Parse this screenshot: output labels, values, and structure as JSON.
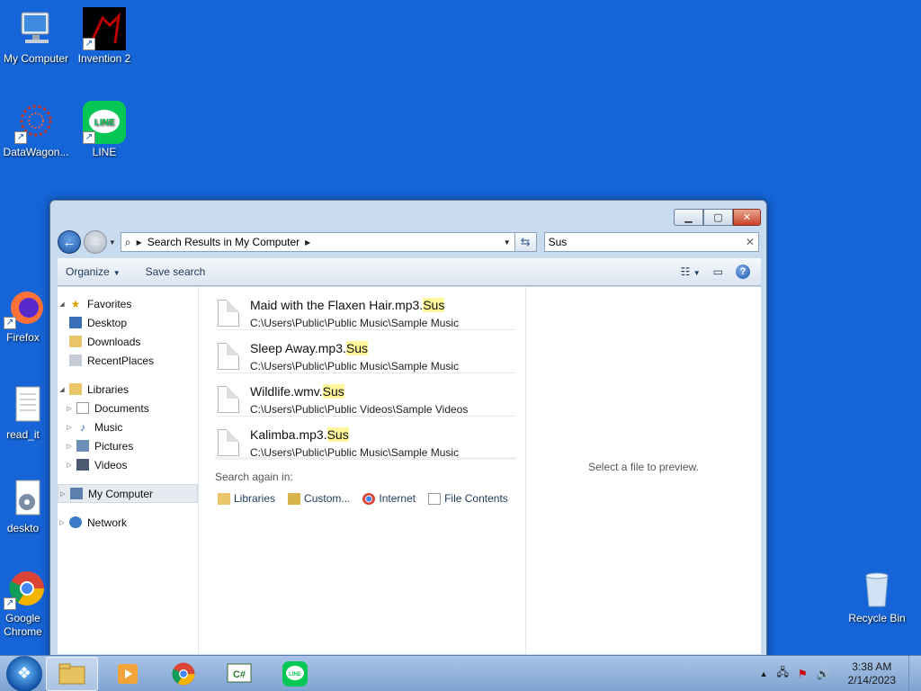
{
  "desktop": {
    "icons": [
      {
        "label": "My Computer",
        "icon": "computer-icon"
      },
      {
        "label": "Invention 2",
        "icon": "invention-icon"
      },
      {
        "label": "DataWagon...",
        "icon": "datawagon-icon"
      },
      {
        "label": "LINE",
        "icon": "line-icon"
      },
      {
        "label": "Firefox",
        "icon": "firefox-icon"
      },
      {
        "label": "read_it",
        "icon": "text-file-icon"
      },
      {
        "label": "deskto",
        "icon": "gear-file-icon"
      },
      {
        "label": "Google Chrome",
        "icon": "chrome-icon"
      },
      {
        "label": "Recycle Bin",
        "icon": "recycle-bin-icon"
      }
    ]
  },
  "explorer": {
    "address": {
      "crumb": "Search Results in My Computer"
    },
    "search": {
      "value": "Sus"
    },
    "toolbar": {
      "organize": "Organize",
      "save_search": "Save search"
    },
    "nav": {
      "favorites": "Favorites",
      "desktop": "Desktop",
      "downloads": "Downloads",
      "recent": "RecentPlaces",
      "libraries": "Libraries",
      "documents": "Documents",
      "music": "Music",
      "pictures": "Pictures",
      "videos": "Videos",
      "computer": "My Computer",
      "network": "Network"
    },
    "results": [
      {
        "name": "Maid with the Flaxen Hair.mp3.",
        "match": "Sus",
        "path": "C:\\Users\\Public\\Public Music\\Sample Music"
      },
      {
        "name": "Sleep Away.mp3.",
        "match": "Sus",
        "path": "C:\\Users\\Public\\Public Music\\Sample Music"
      },
      {
        "name": "Wildlife.wmv.",
        "match": "Sus",
        "path": "C:\\Users\\Public\\Public Videos\\Sample Videos"
      },
      {
        "name": "Kalimba.mp3.",
        "match": "Sus",
        "path": "C:\\Users\\Public\\Public Music\\Sample Music"
      }
    ],
    "search_again": {
      "label": "Search again in:",
      "options": [
        "Libraries",
        "Custom...",
        "Internet",
        "File Contents"
      ]
    },
    "preview": "Select a file to preview."
  },
  "taskbar": {
    "time": "3:38 AM",
    "date": "2/14/2023"
  },
  "colors": {
    "desktop": "#1565d8",
    "highlight": "#fff799"
  }
}
